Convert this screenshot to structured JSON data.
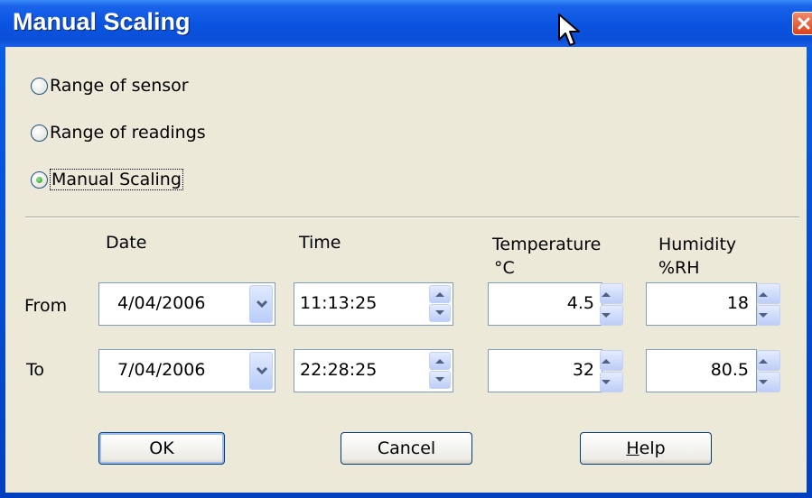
{
  "window": {
    "title": "Manual Scaling"
  },
  "radios": [
    {
      "label": "Range of sensor",
      "checked": false
    },
    {
      "label": "Range of readings",
      "checked": false
    },
    {
      "label": "Manual Scaling",
      "checked": true
    }
  ],
  "columns": {
    "date": "Date",
    "time": "Time",
    "temp_title": "Temperature",
    "temp_unit": "°C",
    "hum_title": "Humidity",
    "hum_unit": "%RH"
  },
  "rows": {
    "from": {
      "label": "From",
      "date": "4/04/2006",
      "time": "11:13:25",
      "temperature": "4.5",
      "humidity": "18"
    },
    "to": {
      "label": "To",
      "date": "7/04/2006",
      "time": "22:28:25",
      "temperature": "32",
      "humidity": "80.5"
    }
  },
  "buttons": {
    "ok": "OK",
    "cancel": "Cancel",
    "help_mnemonic": "H",
    "help_rest": "elp"
  },
  "colors": {
    "titlebar": "#0a4fd8",
    "face": "#ece9d8",
    "close": "#d8421a"
  },
  "icons": [
    "close-icon",
    "mouse-cursor-icon",
    "chevron-down-icon",
    "arrow-up-icon",
    "arrow-down-icon"
  ]
}
